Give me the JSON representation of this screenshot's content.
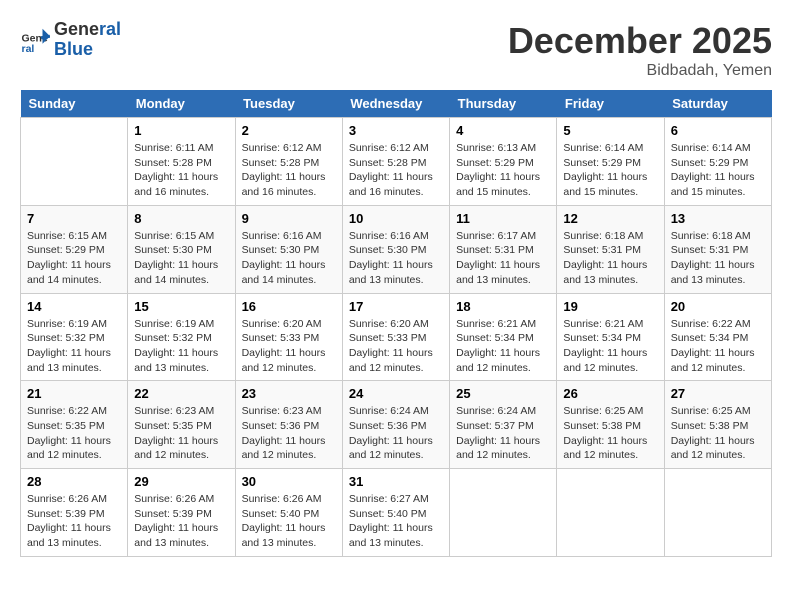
{
  "logo": {
    "text_general": "General",
    "text_blue": "Blue"
  },
  "header": {
    "month_year": "December 2025",
    "location": "Bidbadah, Yemen"
  },
  "days_of_week": [
    "Sunday",
    "Monday",
    "Tuesday",
    "Wednesday",
    "Thursday",
    "Friday",
    "Saturday"
  ],
  "weeks": [
    [
      {
        "day": "",
        "info": ""
      },
      {
        "day": "1",
        "sunrise": "6:11 AM",
        "sunset": "5:28 PM",
        "daylight": "11 hours and 16 minutes."
      },
      {
        "day": "2",
        "sunrise": "6:12 AM",
        "sunset": "5:28 PM",
        "daylight": "11 hours and 16 minutes."
      },
      {
        "day": "3",
        "sunrise": "6:12 AM",
        "sunset": "5:28 PM",
        "daylight": "11 hours and 16 minutes."
      },
      {
        "day": "4",
        "sunrise": "6:13 AM",
        "sunset": "5:29 PM",
        "daylight": "11 hours and 15 minutes."
      },
      {
        "day": "5",
        "sunrise": "6:14 AM",
        "sunset": "5:29 PM",
        "daylight": "11 hours and 15 minutes."
      },
      {
        "day": "6",
        "sunrise": "6:14 AM",
        "sunset": "5:29 PM",
        "daylight": "11 hours and 15 minutes."
      }
    ],
    [
      {
        "day": "7",
        "sunrise": "6:15 AM",
        "sunset": "5:29 PM",
        "daylight": "11 hours and 14 minutes."
      },
      {
        "day": "8",
        "sunrise": "6:15 AM",
        "sunset": "5:30 PM",
        "daylight": "11 hours and 14 minutes."
      },
      {
        "day": "9",
        "sunrise": "6:16 AM",
        "sunset": "5:30 PM",
        "daylight": "11 hours and 14 minutes."
      },
      {
        "day": "10",
        "sunrise": "6:16 AM",
        "sunset": "5:30 PM",
        "daylight": "11 hours and 13 minutes."
      },
      {
        "day": "11",
        "sunrise": "6:17 AM",
        "sunset": "5:31 PM",
        "daylight": "11 hours and 13 minutes."
      },
      {
        "day": "12",
        "sunrise": "6:18 AM",
        "sunset": "5:31 PM",
        "daylight": "11 hours and 13 minutes."
      },
      {
        "day": "13",
        "sunrise": "6:18 AM",
        "sunset": "5:31 PM",
        "daylight": "11 hours and 13 minutes."
      }
    ],
    [
      {
        "day": "14",
        "sunrise": "6:19 AM",
        "sunset": "5:32 PM",
        "daylight": "11 hours and 13 minutes."
      },
      {
        "day": "15",
        "sunrise": "6:19 AM",
        "sunset": "5:32 PM",
        "daylight": "11 hours and 13 minutes."
      },
      {
        "day": "16",
        "sunrise": "6:20 AM",
        "sunset": "5:33 PM",
        "daylight": "11 hours and 12 minutes."
      },
      {
        "day": "17",
        "sunrise": "6:20 AM",
        "sunset": "5:33 PM",
        "daylight": "11 hours and 12 minutes."
      },
      {
        "day": "18",
        "sunrise": "6:21 AM",
        "sunset": "5:34 PM",
        "daylight": "11 hours and 12 minutes."
      },
      {
        "day": "19",
        "sunrise": "6:21 AM",
        "sunset": "5:34 PM",
        "daylight": "11 hours and 12 minutes."
      },
      {
        "day": "20",
        "sunrise": "6:22 AM",
        "sunset": "5:34 PM",
        "daylight": "11 hours and 12 minutes."
      }
    ],
    [
      {
        "day": "21",
        "sunrise": "6:22 AM",
        "sunset": "5:35 PM",
        "daylight": "11 hours and 12 minutes."
      },
      {
        "day": "22",
        "sunrise": "6:23 AM",
        "sunset": "5:35 PM",
        "daylight": "11 hours and 12 minutes."
      },
      {
        "day": "23",
        "sunrise": "6:23 AM",
        "sunset": "5:36 PM",
        "daylight": "11 hours and 12 minutes."
      },
      {
        "day": "24",
        "sunrise": "6:24 AM",
        "sunset": "5:36 PM",
        "daylight": "11 hours and 12 minutes."
      },
      {
        "day": "25",
        "sunrise": "6:24 AM",
        "sunset": "5:37 PM",
        "daylight": "11 hours and 12 minutes."
      },
      {
        "day": "26",
        "sunrise": "6:25 AM",
        "sunset": "5:38 PM",
        "daylight": "11 hours and 12 minutes."
      },
      {
        "day": "27",
        "sunrise": "6:25 AM",
        "sunset": "5:38 PM",
        "daylight": "11 hours and 12 minutes."
      }
    ],
    [
      {
        "day": "28",
        "sunrise": "6:26 AM",
        "sunset": "5:39 PM",
        "daylight": "11 hours and 13 minutes."
      },
      {
        "day": "29",
        "sunrise": "6:26 AM",
        "sunset": "5:39 PM",
        "daylight": "11 hours and 13 minutes."
      },
      {
        "day": "30",
        "sunrise": "6:26 AM",
        "sunset": "5:40 PM",
        "daylight": "11 hours and 13 minutes."
      },
      {
        "day": "31",
        "sunrise": "6:27 AM",
        "sunset": "5:40 PM",
        "daylight": "11 hours and 13 minutes."
      },
      {
        "day": "",
        "info": ""
      },
      {
        "day": "",
        "info": ""
      },
      {
        "day": "",
        "info": ""
      }
    ]
  ]
}
